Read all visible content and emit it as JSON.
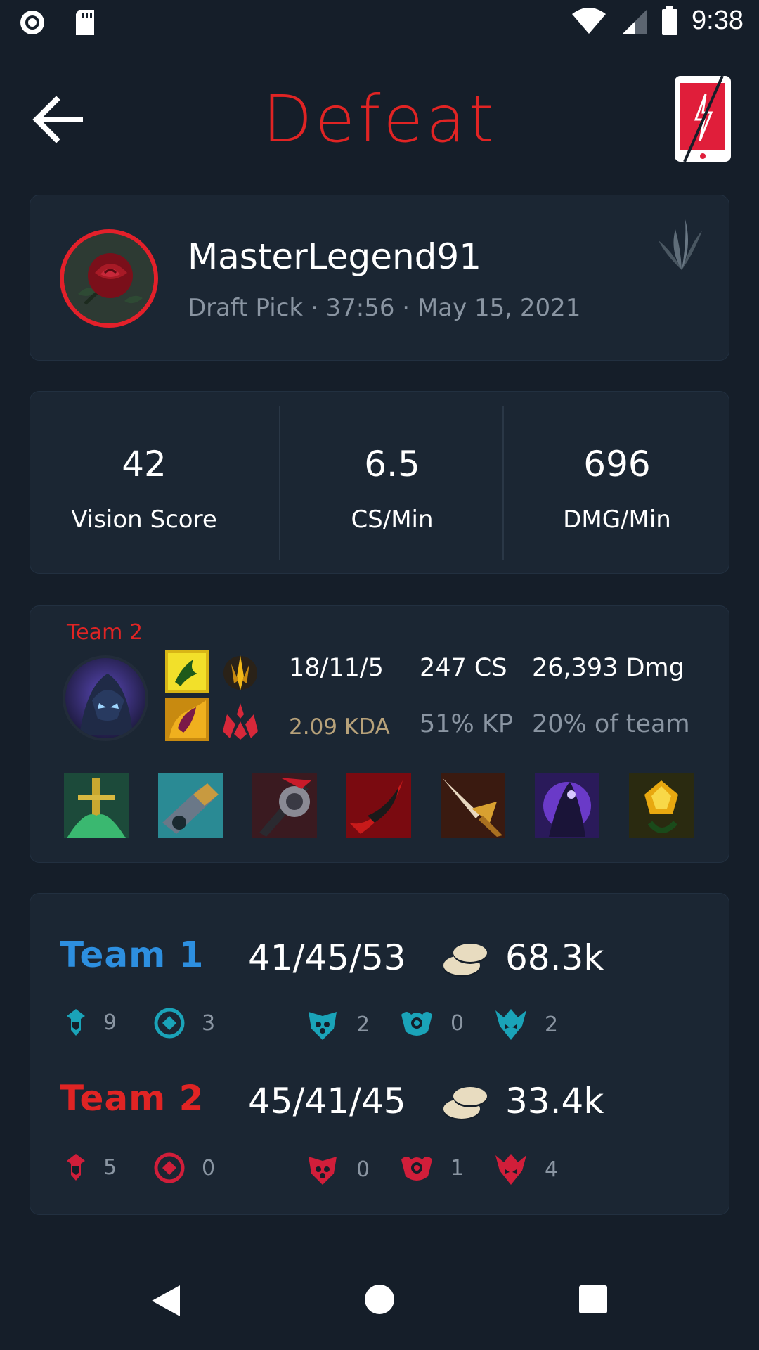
{
  "status_bar": {
    "time": "9:38"
  },
  "header": {
    "title": "Defeat"
  },
  "player": {
    "name": "MasterLegend91",
    "meta": "Draft Pick · 37:56 · May 15, 2021"
  },
  "stats": [
    {
      "value": "42",
      "label": "Vision Score"
    },
    {
      "value": "6.5",
      "label": "CS/Min"
    },
    {
      "value": "696",
      "label": "DMG/Min"
    }
  ],
  "champion": {
    "team_label": "Team 2",
    "kills_deaths_assists": "18/11/5",
    "kda": "2.09 KDA",
    "cs": "247 CS",
    "kp": "51% KP",
    "damage": "26,393 Dmg",
    "damage_share": "20% of team",
    "items": [
      "item-1",
      "item-2",
      "item-3",
      "item-4",
      "item-5",
      "item-6",
      "item-7"
    ]
  },
  "teams": [
    {
      "name": "Team 1",
      "color": "#2d8fe0",
      "kda": "41/45/53",
      "gold": "68.3k",
      "objectives": {
        "towers": "9",
        "inhibitors": "3",
        "barons": "2",
        "heralds": "0",
        "dragons": "2"
      },
      "objective_color": "#1aa3b8"
    },
    {
      "name": "Team 2",
      "color": "#e02424",
      "kda": "45/41/45",
      "gold": "33.4k",
      "objectives": {
        "towers": "5",
        "inhibitors": "0",
        "barons": "0",
        "heralds": "1",
        "dragons": "4"
      },
      "objective_color": "#d11e3a"
    }
  ],
  "colors": {
    "accent": "#e02424",
    "background": "#151e29",
    "card": "#1b2633"
  }
}
